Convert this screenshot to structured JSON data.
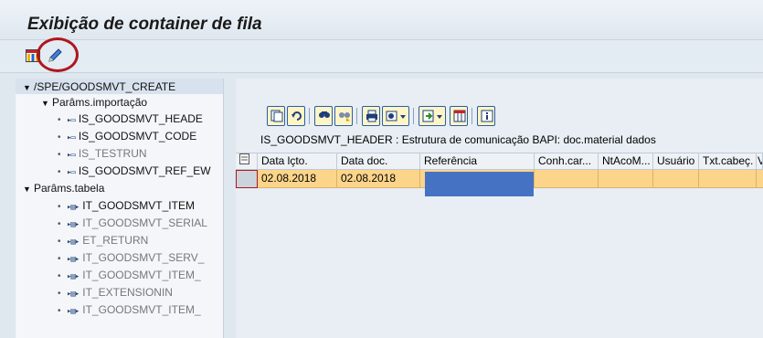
{
  "window": {
    "title": "Exibição de container de fila"
  },
  "toolbar": {
    "buttons": [
      {
        "name": "layout-button",
        "icon": "column-layout-icon"
      },
      {
        "name": "edit-button",
        "icon": "pencil-icon"
      }
    ],
    "highlight_color": "#b0161b"
  },
  "tree": {
    "root": "/SPE/GOODSMVT_CREATE",
    "import_group": "Parâms.importação",
    "import_params": [
      {
        "label": "IS_GOODSMVT_HEADE",
        "dim": false
      },
      {
        "label": "IS_GOODSMVT_CODE",
        "dim": false
      },
      {
        "label": "IS_TESTRUN",
        "dim": true
      },
      {
        "label": "IS_GOODSMVT_REF_EW",
        "dim": false
      }
    ],
    "table_group": "Parâms.tabela",
    "table_params": [
      {
        "label": "IT_GOODSMVT_ITEM",
        "dim": false
      },
      {
        "label": "IT_GOODSMVT_SERIAL",
        "dim": true
      },
      {
        "label": "ET_RETURN",
        "dim": true
      },
      {
        "label": "IT_GOODSMVT_SERV_",
        "dim": true
      },
      {
        "label": "IT_GOODSMVT_ITEM_",
        "dim": true
      },
      {
        "label": "IT_EXTENSIONIN",
        "dim": true
      },
      {
        "label": "IT_GOODSMVT_ITEM_",
        "dim": true
      }
    ],
    "import_icon": "structure-icon",
    "table_icon": "table-icon"
  },
  "alv": {
    "toolbar_icons": [
      "details-icon",
      "refresh-icon",
      "find-icon",
      "find-next-icon",
      "print-icon",
      "export-icon",
      "views-icon",
      "layout-icon",
      "info-icon"
    ],
    "title": "IS_GOODSMVT_HEADER : Estrutura de comunicação BAPI: doc.material dados",
    "columns": [
      "Data lçto.",
      "Data doc.",
      "Referência",
      "Conh.car...",
      "NtAcoM...",
      "Usuário",
      "Txt.cabeç.",
      "V"
    ],
    "rows": [
      {
        "cells": [
          "02.08.2018",
          "02.08.2018",
          "",
          "",
          "",
          "",
          "",
          ""
        ]
      }
    ],
    "row_color": "#fcd58a",
    "redaction_color": "#4672c4"
  }
}
